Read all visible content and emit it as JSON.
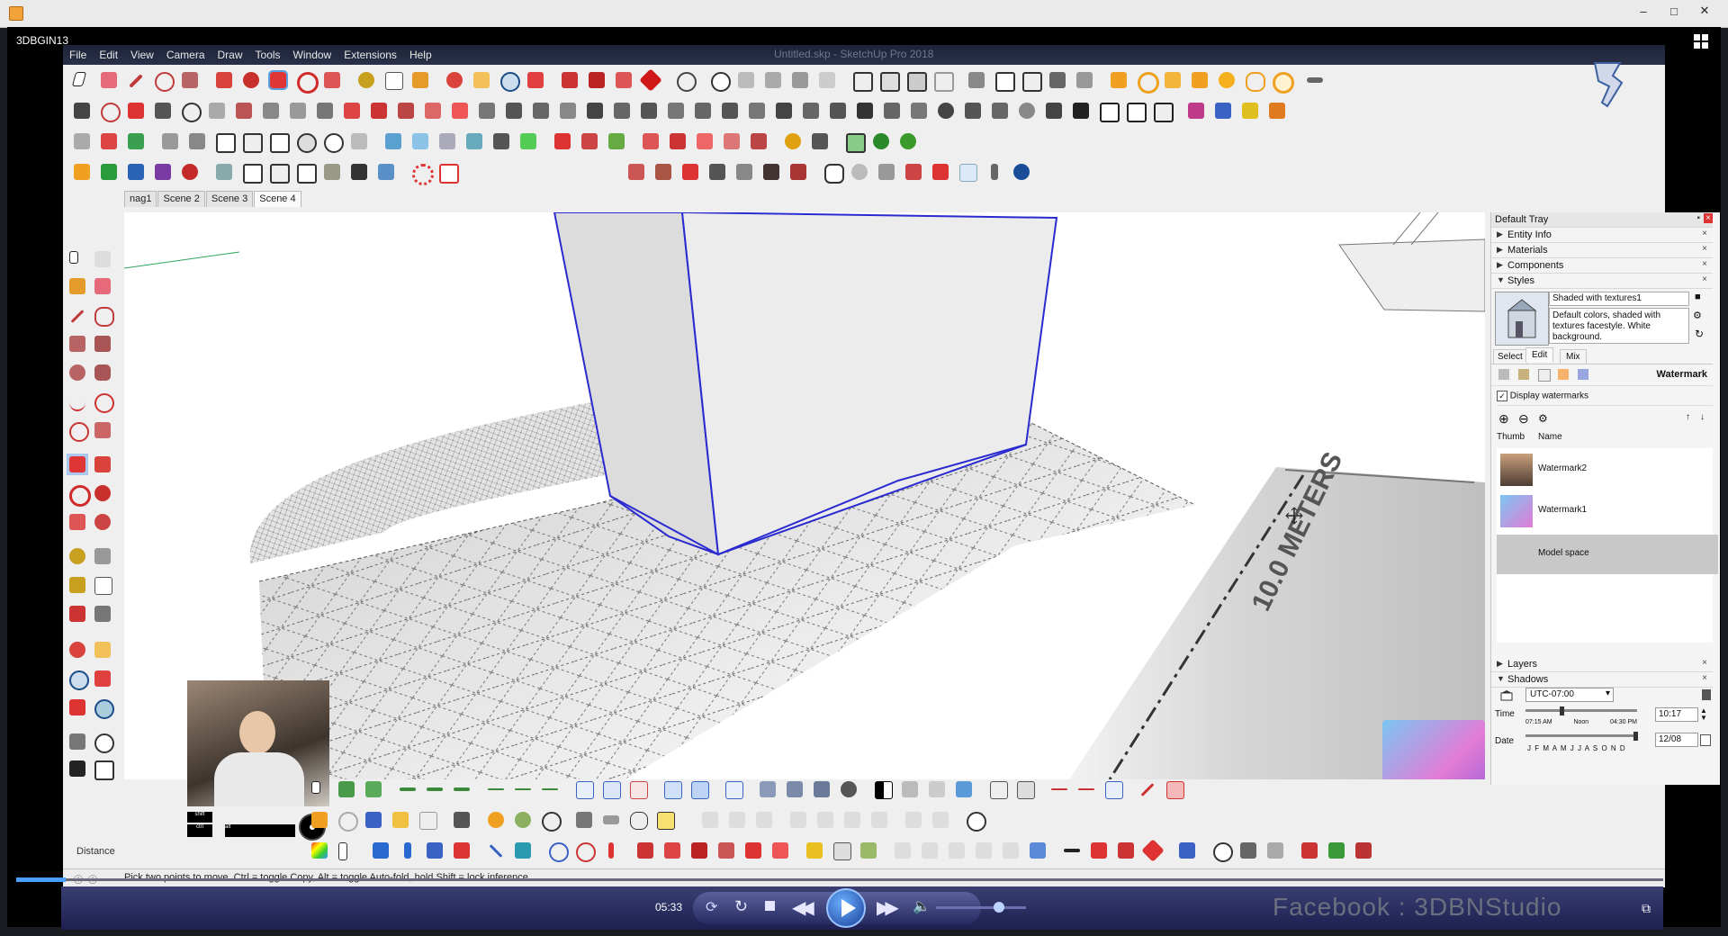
{
  "player": {
    "title_icon": "media-player-icon",
    "video_label": "3DBGIN13",
    "time_elapsed": "05:33",
    "watermark_text": "Facebook : 3DBNStudio",
    "progress_fraction": 0.03,
    "volume_fraction": 0.7
  },
  "sketchup": {
    "window_title": "Untitled.skp - SketchUp Pro 2018",
    "menu": [
      "File",
      "Edit",
      "View",
      "Camera",
      "Draw",
      "Tools",
      "Window",
      "Extensions",
      "Help"
    ],
    "scene_tabs": [
      {
        "label": "nag1",
        "active": false
      },
      {
        "label": "Scene 2",
        "active": false
      },
      {
        "label": "Scene 3",
        "active": false
      },
      {
        "label": "Scene 4",
        "active": true
      }
    ],
    "viewport_text": "10.0 METERS",
    "measurement_label": "Distance",
    "status_text": "Pick two points to move.  Ctrl = toggle Copy, Alt = toggle Auto-fold, hold Shift = lock inference.",
    "webcam_caption_1": "shift",
    "webcam_caption_2": "ctrl",
    "webcam_caption_3": "alt"
  },
  "tray": {
    "title": "Default Tray",
    "sections_top": [
      {
        "label": "Entity Info",
        "expanded": false
      },
      {
        "label": "Materials",
        "expanded": false
      },
      {
        "label": "Components",
        "expanded": false
      },
      {
        "label": "Styles",
        "expanded": true
      }
    ],
    "style_name": "Shaded with textures1",
    "style_desc": "Default colors, shaded with textures facestyle. White background.",
    "style_tabs": [
      "Select",
      "Edit",
      "Mix"
    ],
    "section_title": "Watermark",
    "display_watermarks_label": "Display watermarks",
    "display_watermarks_checked": true,
    "list_headers": {
      "thumb": "Thumb",
      "name": "Name"
    },
    "watermarks": [
      "Watermark2",
      "Watermark1"
    ],
    "model_space": "Model space",
    "sections_bottom": [
      {
        "label": "Layers",
        "expanded": false
      },
      {
        "label": "Shadows",
        "expanded": true
      }
    ],
    "shadows": {
      "timezone": "UTC-07:00",
      "time_label": "Time",
      "date_label": "Date",
      "time_ticks": [
        "07:15 AM",
        "Noon",
        "04:30 PM"
      ],
      "months": "J F M A M J J A S O N D",
      "time_value": "10:17",
      "date_value": "12/08"
    }
  },
  "colors": {
    "menu_bg": "#1c2337",
    "selection_blue": "#2a2ad0",
    "accent_red": "#d9433b",
    "accent_orange": "#f0a020",
    "player_blue": "#2a2f66"
  }
}
